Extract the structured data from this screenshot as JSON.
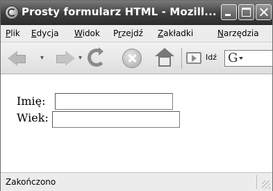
{
  "window": {
    "title": "Prosty formularz HTML - Mozill..."
  },
  "menu": {
    "items": [
      {
        "acc": "P",
        "rest": "lik"
      },
      {
        "acc": "E",
        "rest": "dycja"
      },
      {
        "acc": "W",
        "rest": "idok"
      },
      {
        "pre": "P",
        "acc": "r",
        "rest": "zejdź"
      },
      {
        "acc": "Z",
        "rest": "akładki"
      },
      {
        "acc": "N",
        "rest": "arzędzia"
      }
    ]
  },
  "toolbar": {
    "go_label": "Idź",
    "search_engine": "G"
  },
  "form": {
    "name_label": "Imię:",
    "name_value": "",
    "age_label": "Wiek:",
    "age_value": ""
  },
  "status": {
    "text": "Zakończono"
  }
}
